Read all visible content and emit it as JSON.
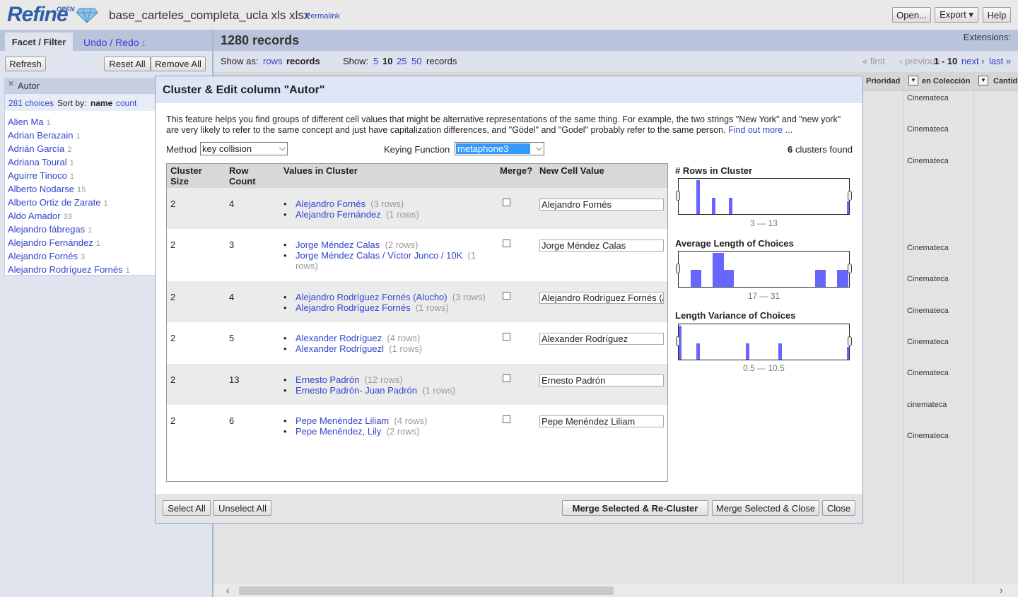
{
  "app": {
    "logo_text": "Refine",
    "logo_open": "OPEN",
    "project_title": "base_carteles_completa_ucla xls xlsx",
    "permalink": "Permalink",
    "top_buttons": {
      "open": "Open...",
      "export": "Export ▾",
      "help": "Help"
    }
  },
  "left_panel": {
    "tab_facet": "Facet / Filter",
    "tab_undo": "Undo / Redo",
    "tab_undo_count": "1",
    "refresh": "Refresh",
    "reset_all": "Reset All",
    "remove_all": "Remove All",
    "facet": {
      "title": "Autor",
      "choices": "281 choices",
      "sort_by": "Sort by:",
      "sort_name": "name",
      "sort_count": "count",
      "items": [
        {
          "name": "Alien Ma",
          "count": "1"
        },
        {
          "name": "Adrian Berazain",
          "count": "1"
        },
        {
          "name": "Adrián García",
          "count": "2"
        },
        {
          "name": "Adriana Toural",
          "count": "1"
        },
        {
          "name": "Aguirre Tinoco",
          "count": "1"
        },
        {
          "name": "Alberto Nodarse",
          "count": "15"
        },
        {
          "name": "Alberto Ortiz de Zarate",
          "count": "1"
        },
        {
          "name": "Aldo Amador",
          "count": "33"
        },
        {
          "name": "Alejandro fábregas",
          "count": "1"
        },
        {
          "name": "Alejandro Fernández",
          "count": "1"
        },
        {
          "name": "Alejandro Fornés",
          "count": "3"
        },
        {
          "name": "Alejandro Rodríguez Fornés",
          "count": "1"
        }
      ]
    }
  },
  "workspace": {
    "records_title": "1280 records",
    "extensions": "Extensions:",
    "show_as": "Show as:",
    "show_as_rows": "rows",
    "show_as_records": "records",
    "show": "Show:",
    "page_sizes": [
      "5",
      "10",
      "25",
      "50"
    ],
    "records_word": "records",
    "pager": {
      "first": "« first",
      "previous": "‹ previous",
      "range": "1 - 10",
      "next": "next ›",
      "last": "last »"
    },
    "columns": {
      "prioridad": "Prioridad",
      "en_coleccion": "en Colección",
      "cantidad": "Cantid"
    },
    "coleccion_values": [
      "Cinemateca",
      "Cinemateca",
      "Cinemateca",
      "Cinemateca",
      "Cinemateca",
      "Cinemateca",
      "Cinemateca",
      "Cinemateca",
      "cinemateca",
      "Cinemateca"
    ]
  },
  "dialog": {
    "title": "Cluster & Edit column \"Autor\"",
    "description": "This feature helps you find groups of different cell values that might be alternative representations of the same thing. For example, the two strings \"New York\" and \"new york\" are very likely to refer to the same concept and just have capitalization differences, and \"Gödel\" and \"Godel\" probably refer to the same person.",
    "find_out_more": "Find out more ...",
    "method_label": "Method",
    "method_value": "key collision",
    "keying_label": "Keying Function",
    "keying_value": "metaphone3",
    "clusters_found_count": "6",
    "clusters_found_text": "clusters found",
    "headers": {
      "cluster_size": "Cluster Size",
      "row_count": "Row Count",
      "values": "Values in Cluster",
      "merge": "Merge?",
      "new_value": "New Cell Value"
    },
    "clusters": [
      {
        "size": "2",
        "rows": "4",
        "new_value": "Alejandro Fornés",
        "values": [
          {
            "v": "Alejandro Fornés",
            "r": "(3 rows)"
          },
          {
            "v": "Alejandro Fernández",
            "r": "(1 rows)"
          }
        ]
      },
      {
        "size": "2",
        "rows": "3",
        "new_value": "Jorge Méndez Calas",
        "values": [
          {
            "v": "Jorge Méndez Calas",
            "r": "(2 rows)"
          },
          {
            "v": "Jorge Méndez Calas / Víctor Junco / 10K",
            "r": "(1 rows)"
          }
        ]
      },
      {
        "size": "2",
        "rows": "4",
        "new_value": "Alejandro Rodríguez Fornés (Alucho)",
        "values": [
          {
            "v": "Alejandro Rodríguez Fornés (Alucho)",
            "r": "(3 rows)"
          },
          {
            "v": "Alejandro Rodríguez Fornés",
            "r": "(1 rows)"
          }
        ]
      },
      {
        "size": "2",
        "rows": "5",
        "new_value": "Alexander Rodríguez",
        "values": [
          {
            "v": "Alexander Rodríguez",
            "r": "(4 rows)"
          },
          {
            "v": "Alexander Rodríguezl",
            "r": "(1 rows)"
          }
        ]
      },
      {
        "size": "2",
        "rows": "13",
        "new_value": "Ernesto Padrón",
        "values": [
          {
            "v": "Ernesto Padrón",
            "r": "(12 rows)"
          },
          {
            "v": "Ernesto Padrón- Juan Padrón",
            "r": "(1 rows)"
          }
        ]
      },
      {
        "size": "2",
        "rows": "6",
        "new_value": "Pepe Menéndez Liliam",
        "values": [
          {
            "v": "Pepe Menéndez Liliam",
            "r": "(4 rows)"
          },
          {
            "v": "Pepe Menéndez, Lily",
            "r": "(2 rows)"
          }
        ]
      }
    ],
    "histograms": [
      {
        "title": "# Rows in Cluster",
        "range": "3 — 13"
      },
      {
        "title": "Average Length of Choices",
        "range": "17 — 31"
      },
      {
        "title": "Length Variance of Choices",
        "range": "0.5 — 10.5"
      }
    ],
    "footer": {
      "select_all": "Select All",
      "unselect_all": "Unselect All",
      "merge_recluster": "Merge Selected & Re-Cluster",
      "merge_close": "Merge Selected & Close",
      "close": "Close"
    },
    "accent": "#6666ff"
  }
}
